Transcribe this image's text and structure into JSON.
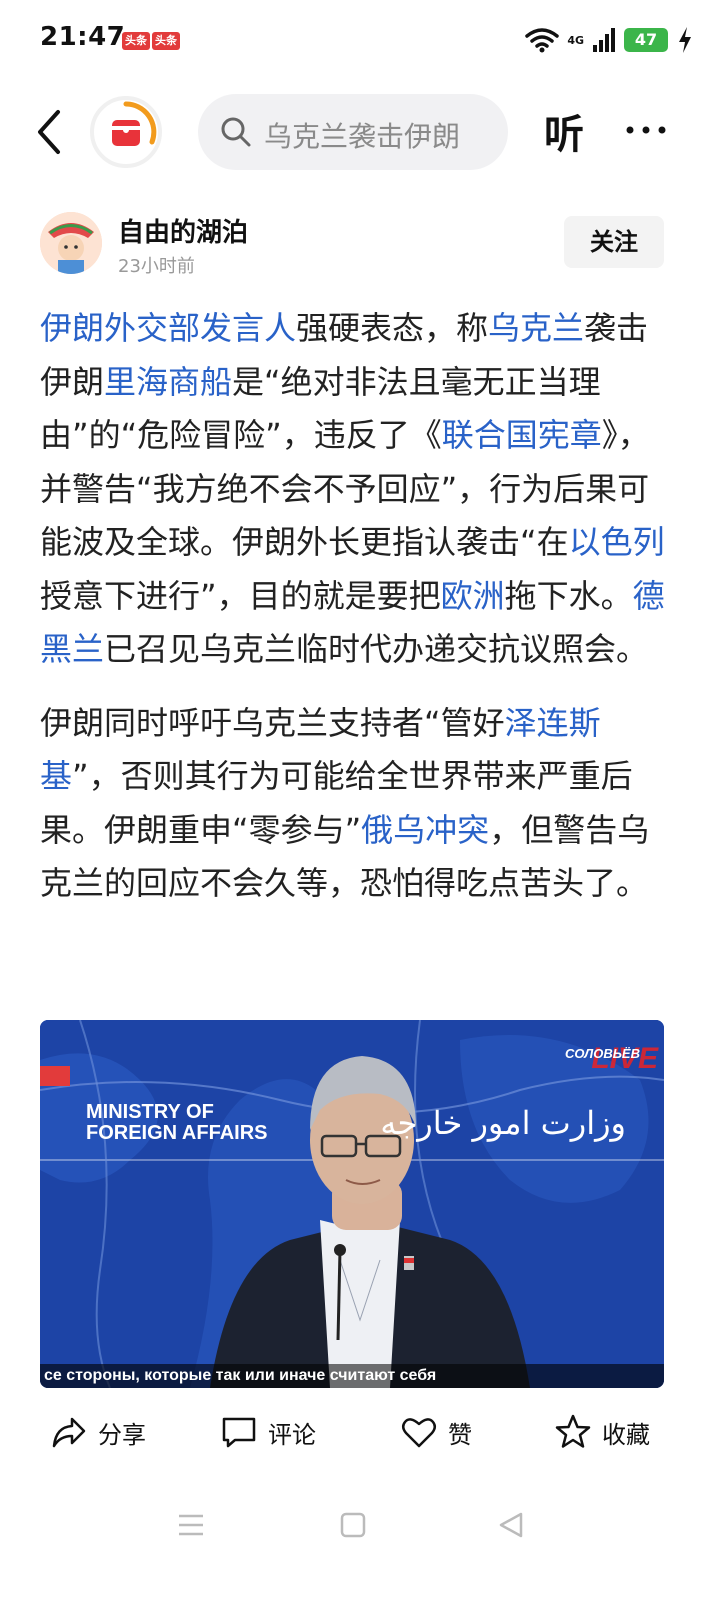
{
  "status_bar": {
    "time": "21:47",
    "badges": [
      "头条",
      "头条"
    ],
    "network": "4G",
    "battery": "47"
  },
  "nav": {
    "search_text": "乌克兰袭击伊朗",
    "listen_label": "听"
  },
  "author": {
    "name": "自由的湖泊",
    "time": "23小时前",
    "follow_label": "关注"
  },
  "article": {
    "p1": {
      "s1": "伊朗外交部发言人",
      "s2": "强硬表态，称",
      "s3": "乌克兰",
      "s4": "袭击伊朗",
      "s5": "里海商船",
      "s6": "是“绝对非法且毫无正当理由”的“危险冒险”，违反了《",
      "s7": "联合国宪章",
      "s8": "》，并警告“我方绝不会不予回应”，行为后果可能波及全球。伊朗外长更指认袭击“在",
      "s9": "以色列",
      "s10": "授意下进行”，目的就是要把",
      "s11": "欧洲",
      "s12": "拖下水。",
      "s13": "德黑兰",
      "s14": "已召见乌克兰临时代办递交抗议照会。"
    },
    "p2": {
      "s1": "伊朗同时呼吁乌克兰支持者“管好",
      "s2": "泽连斯基",
      "s3": "”，否则其行为可能给全世界带来严重后果。伊朗重申“零参与”",
      "s4": "俄乌冲突",
      "s5": "，但警告乌克兰的回应不会久等，恐怕得吃点苦头了。"
    }
  },
  "video": {
    "ministry_label_line1": "MINISTRY OF",
    "ministry_label_line2": "FOREIGN AFFAIRS",
    "persian_label": "وزارت امور خارجه",
    "channel_label": "СОЛОВЬЁВ",
    "live_label": "LIVE",
    "subtitle": "се стороны, которые так или иначе считают себя"
  },
  "actions": {
    "share": "分享",
    "comment": "评论",
    "like": "赞",
    "collect": "收藏"
  },
  "colors": {
    "link": "#2962c8",
    "video_bg": "#1b3f9c",
    "battery": "#3bb54a",
    "brand_red": "#e23b3b"
  }
}
